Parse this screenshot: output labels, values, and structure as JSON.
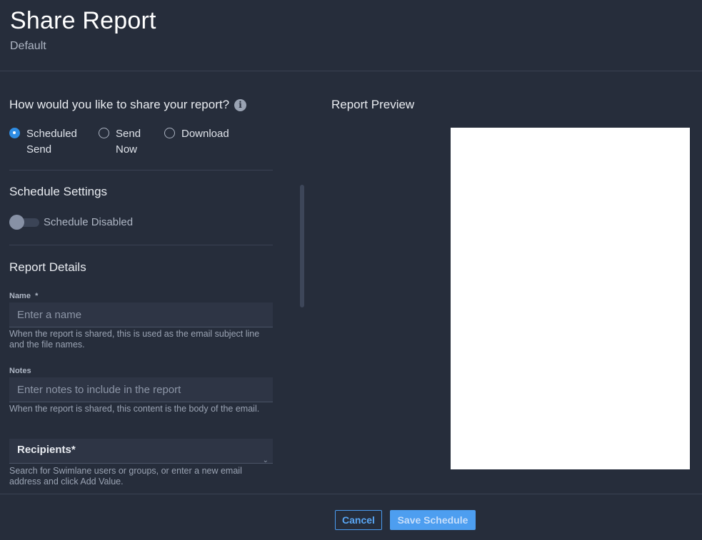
{
  "header": {
    "title": "Share Report",
    "subtitle": "Default"
  },
  "share_options": {
    "question": "How would you like to share your report?",
    "options": [
      {
        "label": "Scheduled Send",
        "checked": true
      },
      {
        "label": "Send Now",
        "checked": false
      },
      {
        "label": "Download",
        "checked": false
      }
    ]
  },
  "schedule_settings": {
    "title": "Schedule Settings",
    "toggle_label": "Schedule Disabled",
    "enabled": false
  },
  "report_details": {
    "title": "Report Details",
    "name": {
      "label": "Name  *",
      "placeholder": "Enter a name",
      "value": "",
      "help": "When the report is shared, this is used as the email subject line and the file names."
    },
    "notes": {
      "label": "Notes",
      "placeholder": "Enter notes to include in the report",
      "value": "",
      "help": "When the report is shared, this content is the body of the email."
    },
    "recipients": {
      "label": "Recipients*",
      "help": "Search for Swimlane users or groups, or enter a new email address and click Add Value."
    }
  },
  "preview": {
    "title": "Report Preview"
  },
  "footer": {
    "cancel_label": "Cancel",
    "save_label": "Save Schedule"
  },
  "colors": {
    "background": "#262d3b",
    "accent": "#2f8de4",
    "input_bg": "#2e3545"
  }
}
